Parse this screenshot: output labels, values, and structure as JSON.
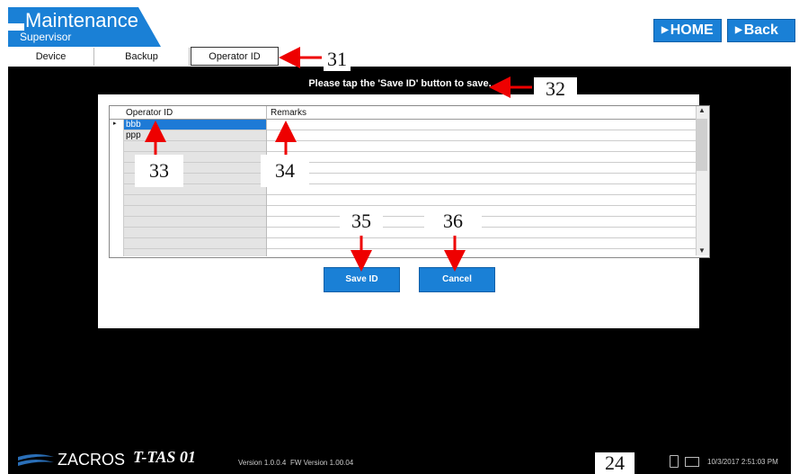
{
  "header": {
    "title": "Maintenance",
    "subtitle": "Supervisor",
    "home_label": "HOME",
    "back_label": "Back",
    "accent": "#1a80d6"
  },
  "tabs": [
    {
      "label": "Device"
    },
    {
      "label": "Backup"
    },
    {
      "label": "Operator ID",
      "active": true
    }
  ],
  "instruction": "Please tap the 'Save ID' button to save.",
  "grid": {
    "columns": [
      "Operator ID",
      "Remarks"
    ],
    "rows": [
      {
        "operator_id": "bbb",
        "remarks": "",
        "selected": true
      },
      {
        "operator_id": "ppp",
        "remarks": ""
      }
    ]
  },
  "buttons": {
    "save": "Save ID",
    "cancel": "Cancel"
  },
  "callouts": {
    "c31": "31",
    "c32": "32",
    "c33": "33",
    "c34": "34",
    "c35": "35",
    "c36": "36",
    "c24": "24"
  },
  "footer": {
    "brand": "ZACROS",
    "product": "T-TAS 01",
    "version": "Version 1.0.0.4",
    "fw_version": "FW Version 1.00.04",
    "datetime": "10/3/2017 2:51:03 PM"
  }
}
